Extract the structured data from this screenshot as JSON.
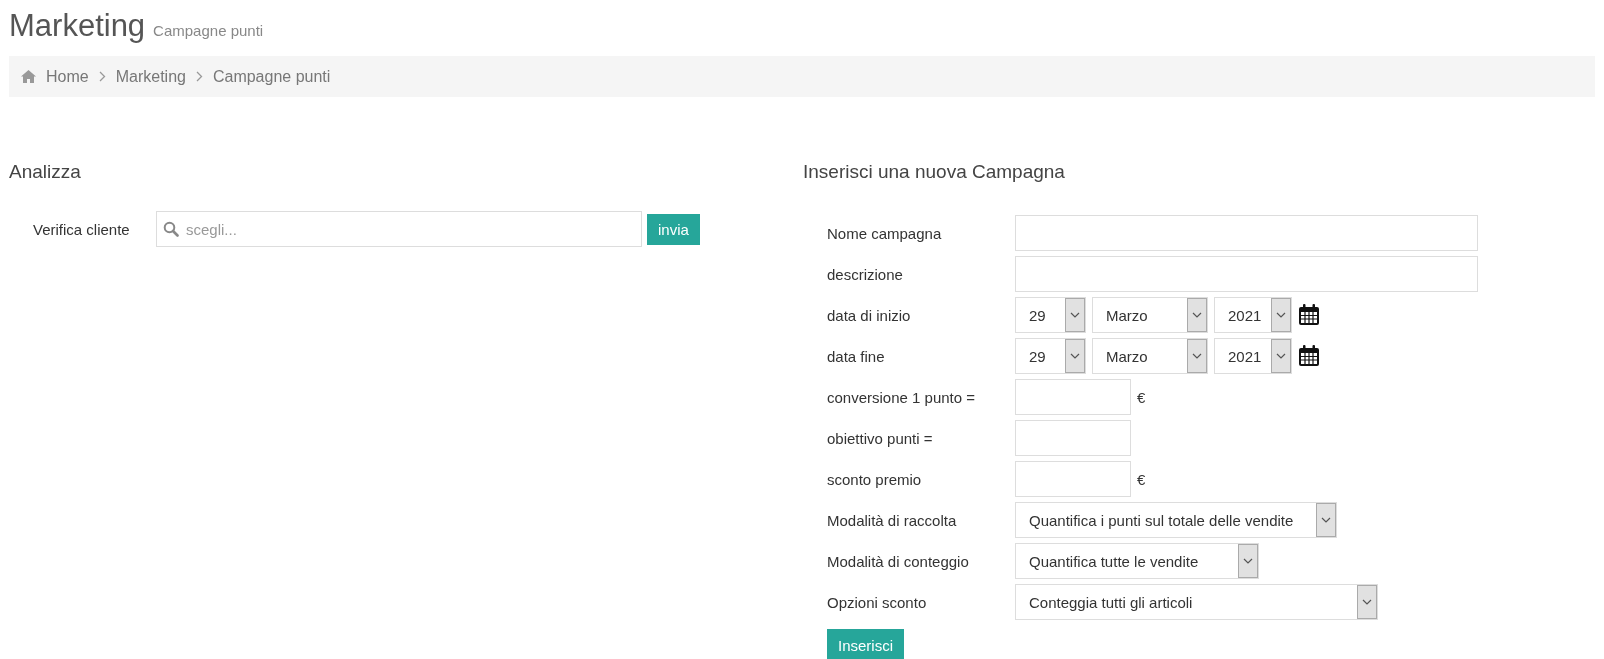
{
  "header": {
    "title": "Marketing",
    "subtitle": "Campagne punti"
  },
  "breadcrumb": [
    {
      "label": "Home"
    },
    {
      "label": "Marketing"
    },
    {
      "label": "Campagne punti"
    }
  ],
  "analyze": {
    "title": "Analizza",
    "label": "Verifica cliente",
    "placeholder": "scegli...",
    "button": "invia"
  },
  "new_campaign": {
    "title": "Inserisci una nuova Campagna",
    "fields": [
      {
        "kind": "text",
        "label": "Nome campagna"
      },
      {
        "kind": "text",
        "label": "descrizione"
      },
      {
        "kind": "date",
        "label": "data di inizio",
        "day": "29",
        "month": "Marzo",
        "year": "2021"
      },
      {
        "kind": "date",
        "label": "data fine",
        "day": "29",
        "month": "Marzo",
        "year": "2021"
      },
      {
        "kind": "number",
        "label": "conversione 1 punto =",
        "unit": "€"
      },
      {
        "kind": "number",
        "label": "obiettivo punti ="
      },
      {
        "kind": "number",
        "label": "sconto premio",
        "unit": "€"
      },
      {
        "kind": "select",
        "label": "Modalità di raccolta",
        "value": "Quantifica i punti sul totale delle vendite"
      },
      {
        "kind": "select",
        "label": "Modalità di conteggio",
        "value": "Quantifica tutte le vendite"
      },
      {
        "kind": "select",
        "label": "Opzioni sconto",
        "value": "Conteggia tutti gli articoli"
      }
    ],
    "button": "Inserisci"
  }
}
